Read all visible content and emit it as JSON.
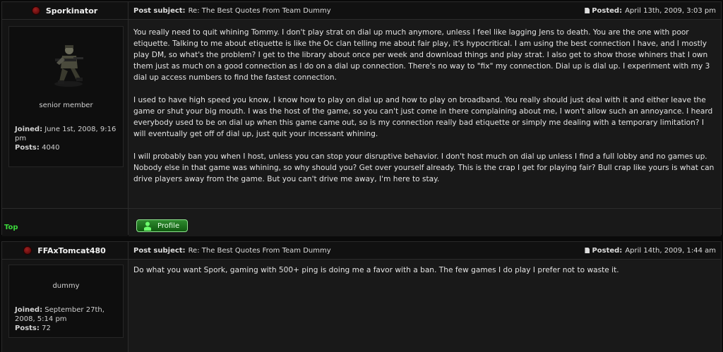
{
  "posts": [
    {
      "author": "Sporkinator",
      "rank": "senior member",
      "joined_label": "Joined:",
      "joined_value": "June 1st, 2008, 9:16 pm",
      "posts_label": "Posts:",
      "posts_value": "4040",
      "subject_label": "Post subject:",
      "subject": "Re: The Best Quotes From Team Dummy",
      "posted_label": "Posted:",
      "posted_value": "April 13th, 2009, 3:03 pm",
      "paragraphs": [
        "You really need to quit whining Tommy. I don't play strat on dial up much anymore, unless I feel like lagging Jens to death. You are the one with poor etiquette. Talking to me about etiquette is like the Oc clan telling me about fair play, it's hypocritical. I am using the best connection I have, and I mostly play DM, so what's the problem? I get to the library about once per week and download things and play strat. I also get to show those whiners that I own them just as much on a good connection as I do on a dial up connection. There's no way to \"fix\" my connection. Dial up is dial up. I experiment with my 3 dial up access numbers to find the fastest connection.",
        "I used to have high speed you know, I know how to play on dial up and how to play on broadband. You really should just deal with it and either leave the game or shut your big mouth. I was the host of the game, so you can't just come in there complaining about me, I won't allow such an annoyance. I heard everybody used to be on dial up when this game came out, so is my connection really bad etiquette or simply me dealing with a temporary limitation? I will eventually get off of dial up, just quit your incessant whining.",
        "I will probably ban you when I host, unless you can stop your disruptive behavior. I don't host much on dial up unless I find a full lobby and no games up. Nobody else in that game was whining, so why should you? Get over yourself already. This is the crap I get for playing fair? Bull crap like yours is what can drive players away from the game. But you can't drive me away, I'm here to stay."
      ],
      "top_link": "Top",
      "profile_button": "Profile"
    },
    {
      "author": "FFAxTomcat480",
      "rank": "dummy",
      "joined_label": "Joined:",
      "joined_value": "September 27th, 2008, 5:14 pm",
      "posts_label": "Posts:",
      "posts_value": "72",
      "subject_label": "Post subject:",
      "subject": "Re: The Best Quotes From Team Dummy",
      "posted_label": "Posted:",
      "posted_value": "April 14th, 2009, 1:44 am",
      "paragraphs": [
        "Do what you want Spork, gaming with 500+ ping is doing me a favor with a ban. The few games I do play I prefer not to waste it."
      ]
    }
  ],
  "colors": {
    "background": "#0a0a0a",
    "accent_green": "#3bd93b",
    "online_dot": "#8a1010"
  },
  "icons": [
    "online-status-icon",
    "post-icon",
    "profile-user-icon",
    "avatar-soldier"
  ]
}
